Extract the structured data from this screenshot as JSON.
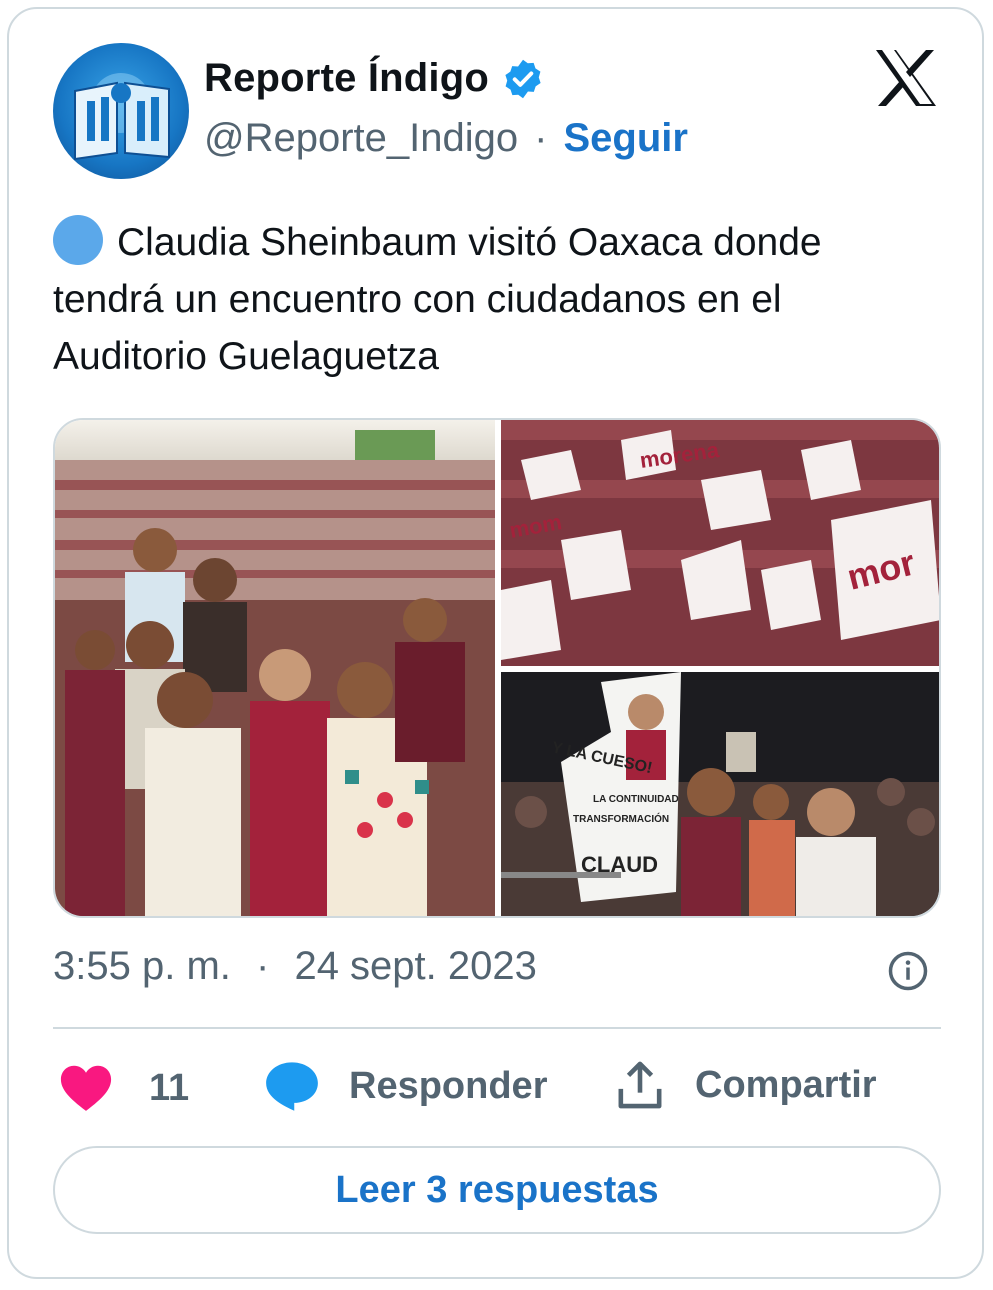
{
  "author": {
    "name": "Reporte Índigo",
    "handle": "@Reporte_Indigo",
    "separator": "·",
    "follow_label": "Seguir",
    "verified_icon": "verified-badge-icon",
    "avatar_color": "#1776c4"
  },
  "tweet": {
    "emoji": "blue-circle",
    "text": "Claudia Sheinbaum visitó Oaxaca donde tendrá un encuentro con ciudadanos en el Auditorio Guelaguetza",
    "media": [
      {
        "description": "group-photo-crowd-stadium"
      },
      {
        "description": "crowd-waving-morena-flags"
      },
      {
        "description": "rally-crowd-with-cutout-sign"
      }
    ],
    "time": "3:55 p. m.",
    "date": "24 sept. 2023",
    "separator": "·"
  },
  "actions": {
    "like_count": "11",
    "reply_label": "Responder",
    "share_label": "Compartir"
  },
  "read_replies_label": "Leer 3 respuestas",
  "colors": {
    "accent": "#1a73c8",
    "like": "#f91880",
    "reply": "#1d9bf0",
    "muted": "#536471",
    "border": "#cfd9de"
  }
}
